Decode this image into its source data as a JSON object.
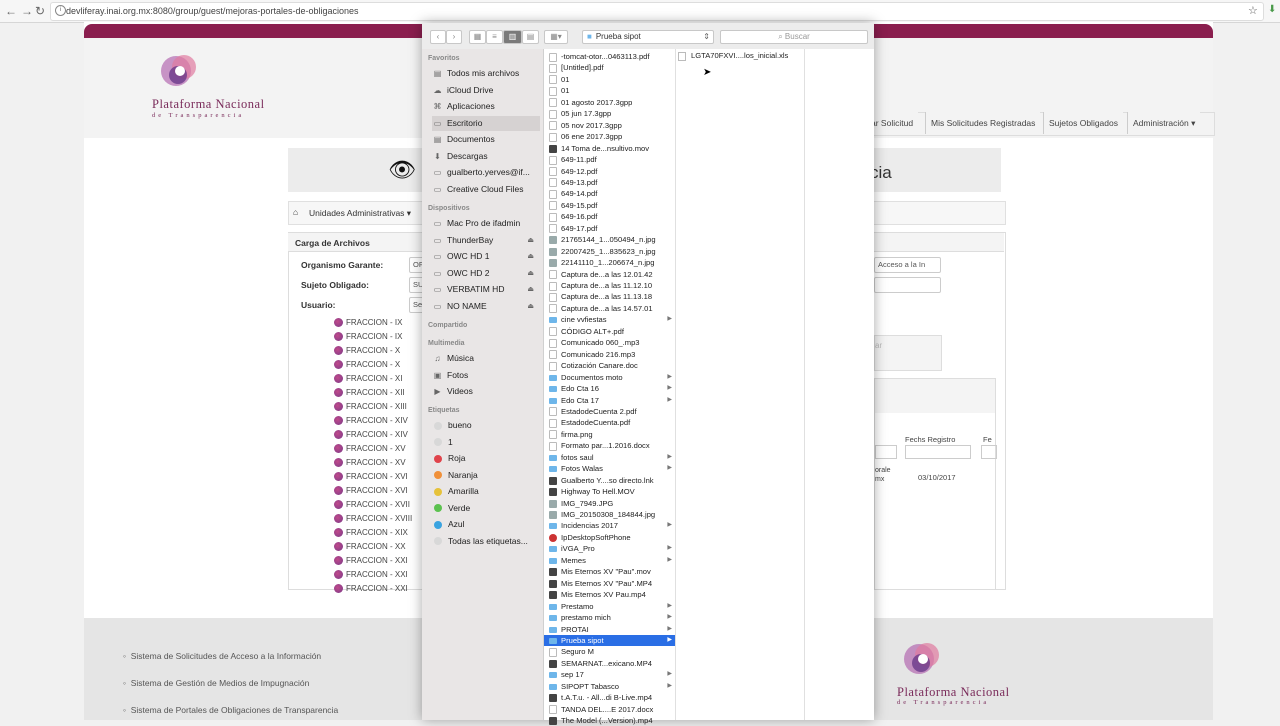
{
  "browser": {
    "url": "devliferay.inai.org.mx:8080/group/guest/mejoras-portales-de-obligaciones"
  },
  "brand": {
    "line1": "Plataforma Nacional",
    "line2": "de Transparencia",
    "accent": "#8a1e4e"
  },
  "nav": {
    "items": [
      "ar Solicitud",
      "Mis Solicitudes Registradas",
      "Sujetos Obligados",
      "Administración"
    ]
  },
  "title": {
    "tail": "cia"
  },
  "breadcrumb": {
    "label": "Unidades Administrativas"
  },
  "form": {
    "panel_title": "Carga de Archivos",
    "organismo_label": "Organismo Garante:",
    "organismo_value": "OF",
    "sujeto_label": "Sujeto Obligado:",
    "sujeto_value": "SU",
    "usuario_label": "Usuario:",
    "usuario_value": "Se",
    "select_right": "Acceso a la In",
    "right_btn": "ar",
    "col_header_1": "Fechs Registro",
    "col_header_2": "Fe",
    "row_snip_1": "orale",
    "row_snip_2": "mx",
    "row_date": "03/10/2017"
  },
  "fracciones": [
    "FRACCION - IX",
    "FRACCION - IX",
    "FRACCION - X",
    "FRACCION - X",
    "FRACCION - XI",
    "FRACCION - XII",
    "FRACCION - XIII",
    "FRACCION - XIV",
    "FRACCION - XIV",
    "FRACCION - XV",
    "FRACCION - XV",
    "FRACCION - XVI",
    "FRACCION - XVI",
    "FRACCION - XVII",
    "FRACCION - XVIII",
    "FRACCION - XIX",
    "FRACCION - XX",
    "FRACCION - XXI",
    "FRACCION - XXI",
    "FRACCION - XXI"
  ],
  "footer": {
    "links": [
      "Sistema de Solicitudes de Acceso a la Información",
      "Sistema de Gestión de Medios de Impugnación",
      "Sistema de Portales de Obligaciones de Transparencia"
    ]
  },
  "finder": {
    "location": "Prueba sipot",
    "search_placeholder": "Buscar",
    "sidebar": {
      "favoritos_header": "Favoritos",
      "favoritos": [
        {
          "label": "Todos mis archivos",
          "icon": "all-files-icon"
        },
        {
          "label": "iCloud Drive",
          "icon": "cloud-icon"
        },
        {
          "label": "Aplicaciones",
          "icon": "apps-icon"
        },
        {
          "label": "Escritorio",
          "icon": "desktop-icon"
        },
        {
          "label": "Documentos",
          "icon": "documents-icon"
        },
        {
          "label": "Descargas",
          "icon": "download-icon"
        },
        {
          "label": "gualberto.yerves@if...",
          "icon": "folder-icon"
        },
        {
          "label": "Creative Cloud Files",
          "icon": "folder-icon"
        }
      ],
      "dispositivos_header": "Dispositivos",
      "dispositivos": [
        {
          "label": "Mac Pro de ifadmin",
          "eject": false
        },
        {
          "label": "ThunderBay",
          "eject": true
        },
        {
          "label": "OWC HD 1",
          "eject": true
        },
        {
          "label": "OWC HD 2",
          "eject": true
        },
        {
          "label": "VERBATIM HD",
          "eject": true
        },
        {
          "label": "NO NAME",
          "eject": true
        }
      ],
      "compartido_header": "Compartido",
      "multimedia_header": "Multimedia",
      "multimedia": [
        {
          "label": "Música",
          "icon": "music-icon"
        },
        {
          "label": "Fotos",
          "icon": "photos-icon"
        },
        {
          "label": "Videos",
          "icon": "video-icon"
        }
      ],
      "etiquetas_header": "Etiquetas",
      "etiquetas": [
        {
          "label": "bueno",
          "color": "#d8d8d8"
        },
        {
          "label": "1",
          "color": "#d8d8d8"
        },
        {
          "label": "Roja",
          "color": "#e0434b"
        },
        {
          "label": "Naranja",
          "color": "#f0903a"
        },
        {
          "label": "Amarilla",
          "color": "#e6c23a"
        },
        {
          "label": "Verde",
          "color": "#5cc24f"
        },
        {
          "label": "Azul",
          "color": "#3aa3e0"
        },
        {
          "label": "Todas las etiquetas...",
          "color": "#d8d8d8"
        }
      ]
    },
    "files": [
      {
        "n": "-tomcat-otor...0463113.pdf",
        "t": "doc"
      },
      {
        "n": "[Untitled].pdf",
        "t": "doc"
      },
      {
        "n": "01",
        "t": "doc"
      },
      {
        "n": "01",
        "t": "doc"
      },
      {
        "n": "01 agosto 2017.3gpp",
        "t": "doc"
      },
      {
        "n": "05 jun 17.3gpp",
        "t": "doc"
      },
      {
        "n": "05 nov 2017.3gpp",
        "t": "doc"
      },
      {
        "n": "06 ene 2017.3gpp",
        "t": "doc"
      },
      {
        "n": "14 Toma de...nsultivo.mov",
        "t": "media"
      },
      {
        "n": "649-11.pdf",
        "t": "doc"
      },
      {
        "n": "649-12.pdf",
        "t": "doc"
      },
      {
        "n": "649-13.pdf",
        "t": "doc"
      },
      {
        "n": "649-14.pdf",
        "t": "doc"
      },
      {
        "n": "649-15.pdf",
        "t": "doc"
      },
      {
        "n": "649-16.pdf",
        "t": "doc"
      },
      {
        "n": "649-17.pdf",
        "t": "doc"
      },
      {
        "n": "21765144_1...050494_n.jpg",
        "t": "img"
      },
      {
        "n": "22007425_1...835623_n.jpg",
        "t": "img"
      },
      {
        "n": "22141110_1...206674_n.jpg",
        "t": "img"
      },
      {
        "n": "Captura de...a las 12.01.42",
        "t": "doc"
      },
      {
        "n": "Captura de...a las 11.12.10",
        "t": "doc"
      },
      {
        "n": "Captura de...a las 11.13.18",
        "t": "doc"
      },
      {
        "n": "Captura de...a las 14.57.01",
        "t": "doc"
      },
      {
        "n": "cine vvfiestas",
        "t": "folder",
        "arrow": true
      },
      {
        "n": "CÓDIGO ALT+.pdf",
        "t": "doc"
      },
      {
        "n": "Comunicado 060_.mp3",
        "t": "doc"
      },
      {
        "n": "Comunicado 216.mp3",
        "t": "doc"
      },
      {
        "n": "Cotización Canare.doc",
        "t": "doc"
      },
      {
        "n": "Documentos moto",
        "t": "folder",
        "arrow": true
      },
      {
        "n": "Edo Cta 16",
        "t": "folder",
        "arrow": true
      },
      {
        "n": "Edo Cta 17",
        "t": "folder",
        "arrow": true
      },
      {
        "n": "EstadodeCuenta 2.pdf",
        "t": "doc"
      },
      {
        "n": "EstadodeCuenta.pdf",
        "t": "doc"
      },
      {
        "n": "firma.png",
        "t": "doc"
      },
      {
        "n": "Formato par...1.2016.docx",
        "t": "doc"
      },
      {
        "n": "fotos saul",
        "t": "folder",
        "arrow": true
      },
      {
        "n": "Fotos Walas",
        "t": "folder",
        "arrow": true
      },
      {
        "n": "Gualberto Y....so directo.lnk",
        "t": "media"
      },
      {
        "n": "Highway To Hell.MOV",
        "t": "media"
      },
      {
        "n": "IMG_7949.JPG",
        "t": "img"
      },
      {
        "n": "IMG_20150308_184844.jpg",
        "t": "img"
      },
      {
        "n": "Incidencias 2017",
        "t": "folder",
        "arrow": true
      },
      {
        "n": "IpDesktopSoftPhone",
        "t": "app"
      },
      {
        "n": "iVGA_Pro",
        "t": "folder",
        "arrow": true
      },
      {
        "n": "Memes",
        "t": "folder",
        "arrow": true
      },
      {
        "n": "Mis Eternos XV \"Pau\".mov",
        "t": "media"
      },
      {
        "n": "Mis Eternos XV \"Pau\".MP4",
        "t": "media"
      },
      {
        "n": "Mis Eternos XV Pau.mp4",
        "t": "media"
      },
      {
        "n": "Prestamo",
        "t": "folder",
        "arrow": true
      },
      {
        "n": "prestamo mich",
        "t": "folder",
        "arrow": true
      },
      {
        "n": "PROTAI",
        "t": "folder",
        "arrow": true
      },
      {
        "n": "Prueba sipot",
        "t": "folder",
        "arrow": true,
        "selected": true
      },
      {
        "n": "Seguro M",
        "t": "doc"
      },
      {
        "n": "SEMARNAT...exicano.MP4",
        "t": "media"
      },
      {
        "n": "sep 17",
        "t": "folder",
        "arrow": true
      },
      {
        "n": "SIPOPT Tabasco",
        "t": "folder",
        "arrow": true
      },
      {
        "n": "t.A.T.u. - All...di B-Live.mp4",
        "t": "media"
      },
      {
        "n": "TANDA DEL....E 2017.docx",
        "t": "doc"
      },
      {
        "n": "The Model (...Version).mp4",
        "t": "media"
      }
    ],
    "subfiles": [
      "LGTA70FXVI....los_inicial.xls"
    ]
  }
}
